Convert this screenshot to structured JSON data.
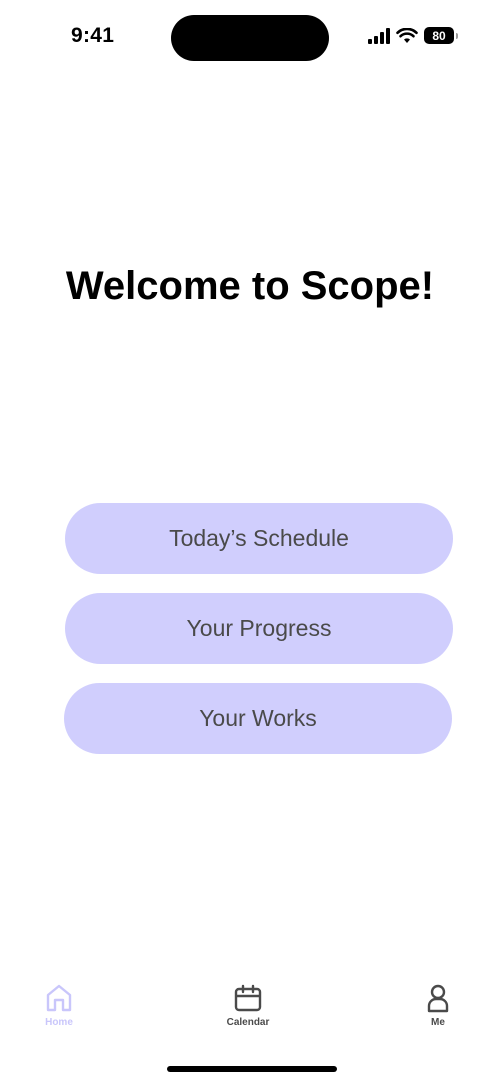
{
  "status_bar": {
    "time": "9:41",
    "battery_level": "80",
    "icons": [
      "cellular-signal-icon",
      "wifi-icon",
      "battery-icon"
    ]
  },
  "main": {
    "title": "Welcome to Scope!",
    "buttons": [
      {
        "label": "Today’s Schedule"
      },
      {
        "label": "Your Progress"
      },
      {
        "label": "Your Works"
      }
    ]
  },
  "tab_bar": {
    "items": [
      {
        "label": "Home",
        "icon": "home-icon",
        "active": true
      },
      {
        "label": "Calendar",
        "icon": "calendar-icon",
        "active": false
      },
      {
        "label": "Me",
        "icon": "person-icon",
        "active": false
      }
    ]
  },
  "colors": {
    "button_bg": "#d0cefd",
    "button_text": "#4a4a4a",
    "tab_active": "#c9c6fb",
    "tab_inactive": "#4a4a4a"
  }
}
